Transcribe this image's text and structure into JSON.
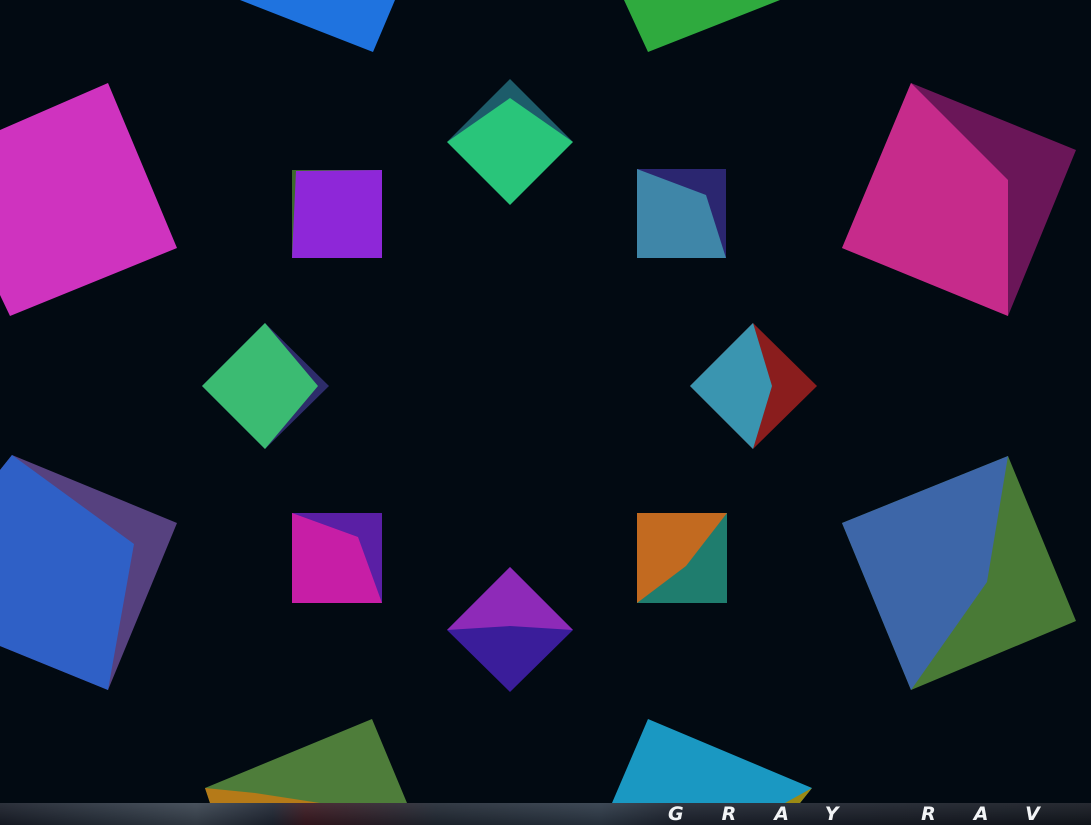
{
  "background_color": "#020a12",
  "brand": {
    "text": "GRAY RAV"
  },
  "colors": {
    "magenta": "#cf33bf",
    "green": "#29c57a",
    "purple": "#8e27d8",
    "steel_blue": "#3f86a8",
    "crimson": "#c62b8b",
    "blue": "#2f60c6",
    "olive": "#497a36",
    "orange": "#c26a20",
    "teal": "#2593c0",
    "red": "#8a1d1d"
  }
}
